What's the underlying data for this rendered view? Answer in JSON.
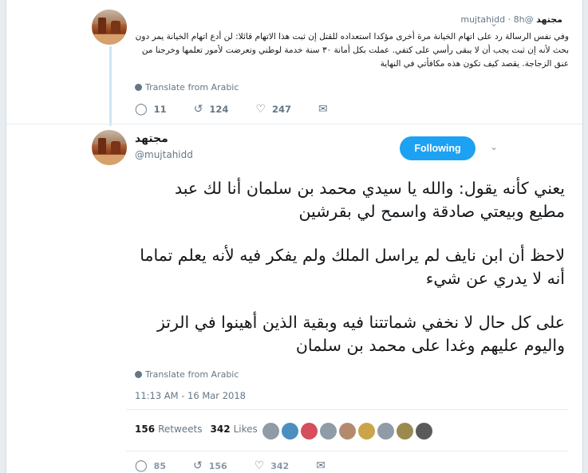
{
  "reply": {
    "name": "مجتهد",
    "handle": "@mujtahidd",
    "time": "8h",
    "text": "وفي نفس الرسالة رد على اتهام الخيانة مرة أخرى مؤكدا استعداده للقتل إن ثبت هذا الاتهام قائلا: لن أدع اتهام الخيانة يمر دون بحث لأنه إن ثبت يجب أن لا يبقى رأسي على كتفي. عملت بكل أمانة ٣٠ سنة خدمة لوطني وتعرضت لأمور تعلمها وخرجنا من عنق الزجاجة. يقصد كيف تكون هذه مكافأتي في النهاية",
    "translate": "Translate from Arabic",
    "replies": "11",
    "retweets": "124",
    "likes": "247"
  },
  "main": {
    "name": "مجتهد",
    "handle": "@mujtahidd",
    "follow_label": "Following",
    "paragraphs": [
      "يعني كأنه يقول: والله يا سيدي محمد بن سلمان أنا لك عبد مطيع وبيعتي صادقة واسمح لي بقرشين",
      "لاحظ أن ابن نايف لم يراسل الملك ولم يفكر فيه لأنه يعلم تماما أنه لا يدري عن شيء",
      "على كل حال لا نخفي شماتتنا فيه وبقية الذين أهينوا في الرتز واليوم عليهم وغدا على محمد بن سلمان"
    ],
    "translate": "Translate from Arabic",
    "timestamp": "11:13 AM - 16 Mar 2018",
    "retweets_count": "156",
    "retweets_label": "Retweets",
    "likes_count": "342",
    "likes_label": "Likes",
    "replies": "85",
    "retweets": "156",
    "likes": "342"
  },
  "colors": {
    "accent": "#1da1f2",
    "muted": "#657786",
    "thread_line": "#cfe6f5"
  },
  "icons": [
    "reply-icon",
    "retweet-icon",
    "heart-icon",
    "message-icon",
    "globe-icon",
    "chevron-down-icon"
  ],
  "likers": [
    {
      "color": "#8f9ba6"
    },
    {
      "color": "#4a8fbf"
    },
    {
      "color": "#d64f5c"
    },
    {
      "color": "#8f9ba6"
    },
    {
      "color": "#b48a6e"
    },
    {
      "color": "#c9a44a"
    },
    {
      "color": "#8f9ba6"
    },
    {
      "color": "#9a8a4f"
    },
    {
      "color": "#5a5a5a"
    }
  ]
}
